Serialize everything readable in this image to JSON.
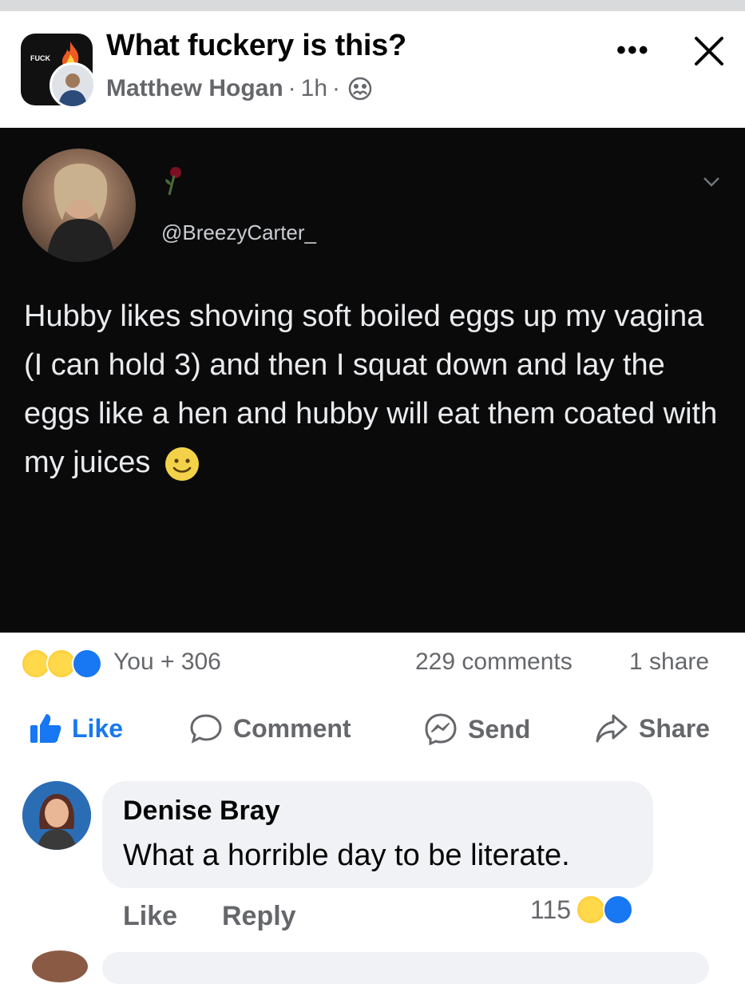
{
  "post": {
    "title": "What fuckery is this?",
    "author": "Matthew Hogan",
    "time": "1h",
    "separator": "·",
    "group_avatar_text": "FUCK"
  },
  "tweet": {
    "handle": "@BreezyCarter_",
    "text": "Hubby likes shoving soft boiled eggs up my vagina (I can hold 3) and then I squat down and lay the eggs like a hen and hubby will eat them coated with my juices"
  },
  "stats": {
    "reactions_label": "You + 306",
    "comments": "229 comments",
    "shares": "1 share"
  },
  "actions": {
    "like": "Like",
    "comment": "Comment",
    "send": "Send",
    "share": "Share"
  },
  "comment": {
    "author": "Denise Bray",
    "text": "What a horrible day to be literate.",
    "like": "Like",
    "reply": "Reply",
    "reaction_count": "115"
  },
  "colors": {
    "accent": "#1877f2",
    "muted": "#65676b",
    "tweet_bg": "#0a0a0a",
    "bubble": "#f0f2f5"
  }
}
